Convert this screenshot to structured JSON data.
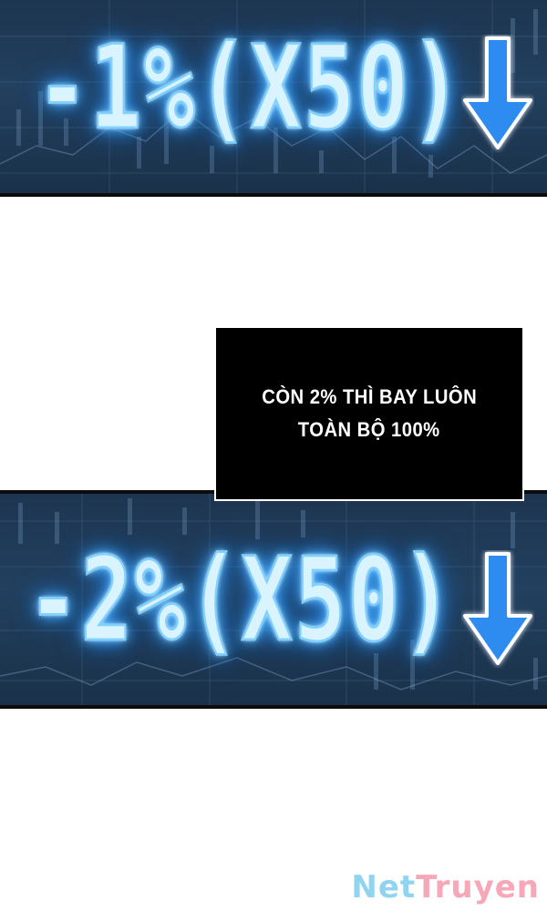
{
  "panel_top": {
    "text": "-1%(X50)",
    "arrow_icon": "down-arrow-icon"
  },
  "caption": {
    "line1": "CÒN 2% THÌ BAY LUÔN",
    "line2": "TOÀN BỘ 100%"
  },
  "panel_bottom": {
    "text": "-2%(X50)",
    "arrow_icon": "down-arrow-icon"
  },
  "watermark": {
    "part1": "Net",
    "part2": "Truyen"
  },
  "colors": {
    "panel_background": "#1d3550",
    "glow_text": "#d9f4ff",
    "glow": "#2f9bff",
    "arrow": "#2d8cf0",
    "caption_background": "#000000",
    "caption_text": "#ffffff",
    "watermark_net": "#8fd4f0",
    "watermark_truyen": "#f7a8b8"
  }
}
